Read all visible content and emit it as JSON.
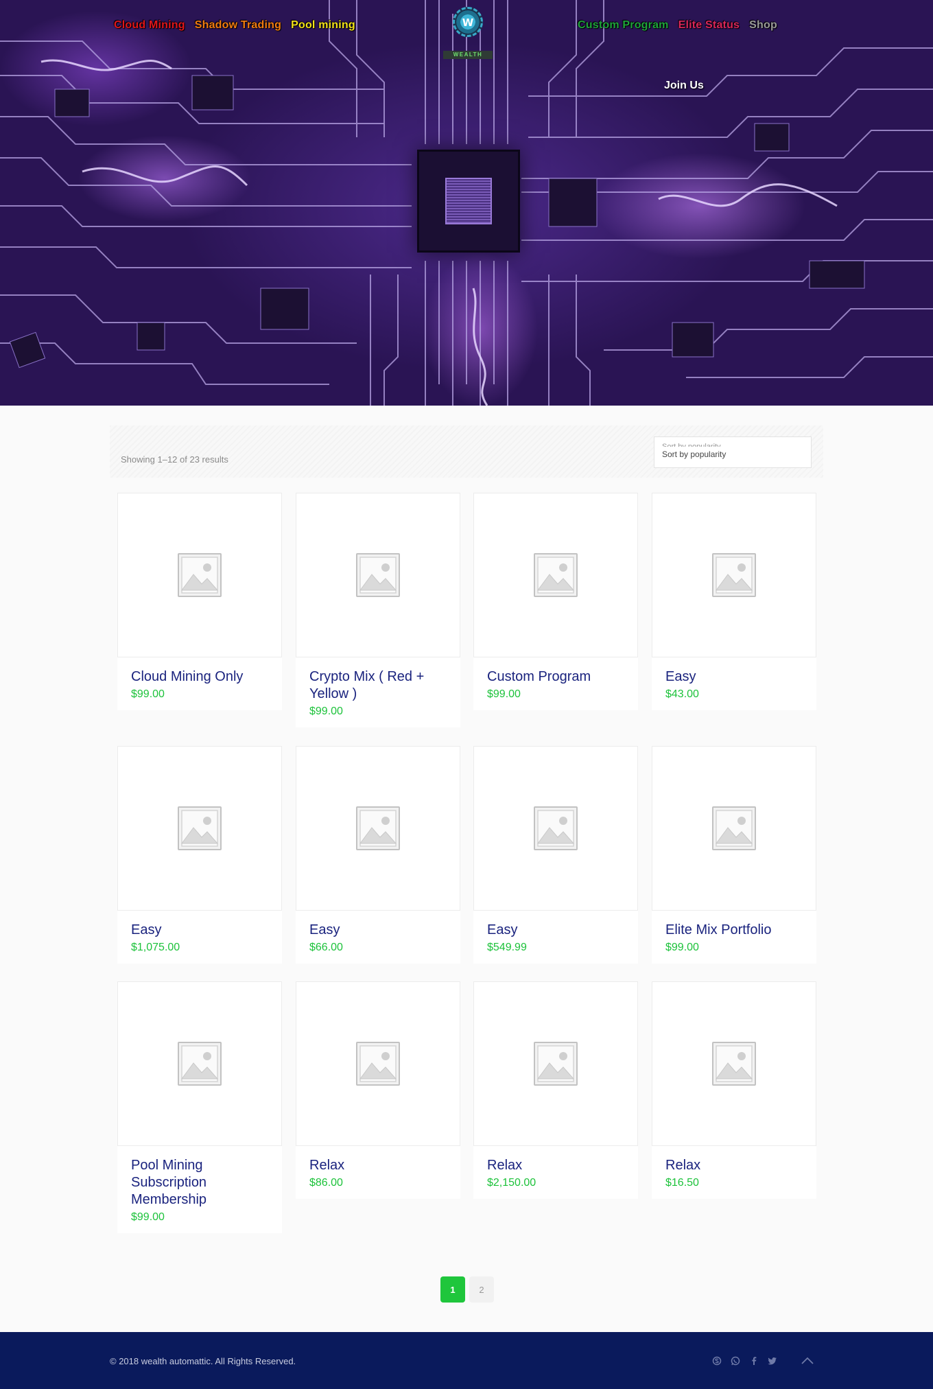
{
  "header": {
    "nav_left": [
      {
        "label": "Cloud Mining",
        "color": "#e0161c"
      },
      {
        "label": "Shadow Trading",
        "color": "#f07b12"
      },
      {
        "label": "Pool mining",
        "color": "#f2e11a"
      }
    ],
    "nav_right": [
      {
        "label": "Custom Program",
        "color": "#1fa33c"
      },
      {
        "label": "Elite Status",
        "color": "#d8265a"
      },
      {
        "label": "Shop",
        "color": "#9a9a9a"
      }
    ],
    "join_label": "Join Us",
    "logo": {
      "letter": "W",
      "text": "WEALTH"
    }
  },
  "shop": {
    "result_count": "Showing 1–12 of 23 results",
    "sort_ghost": "Sort by popularity",
    "sort_label": "Sort by popularity"
  },
  "products": [
    {
      "title": "Cloud Mining Only",
      "price": "$99.00"
    },
    {
      "title": "Crypto Mix ( Red + Yellow )",
      "price": "$99.00"
    },
    {
      "title": "Custom Program",
      "price": "$99.00"
    },
    {
      "title": "Easy",
      "price": "$43.00"
    },
    {
      "title": "Easy",
      "price": "$1,075.00"
    },
    {
      "title": "Easy",
      "price": "$66.00"
    },
    {
      "title": "Easy",
      "price": "$549.99"
    },
    {
      "title": "Elite Mix Portfolio",
      "price": "$99.00"
    },
    {
      "title": "Pool Mining Subscription Membership",
      "price": "$99.00"
    },
    {
      "title": "Relax",
      "price": "$86.00"
    },
    {
      "title": "Relax",
      "price": "$2,150.00"
    },
    {
      "title": "Relax",
      "price": "$16.50"
    }
  ],
  "pagination": {
    "current": "1",
    "next": "2"
  },
  "footer": {
    "copyright": "© 2018 wealth automattic. All Rights Reserved.",
    "social_icons": [
      "skype-icon",
      "whatsapp-icon",
      "facebook-icon",
      "twitter-icon"
    ]
  },
  "colors": {
    "price": "#1cc23a",
    "title": "#1a237e",
    "footer_bg": "#0a1a5c",
    "accent": "#1fc63c"
  }
}
